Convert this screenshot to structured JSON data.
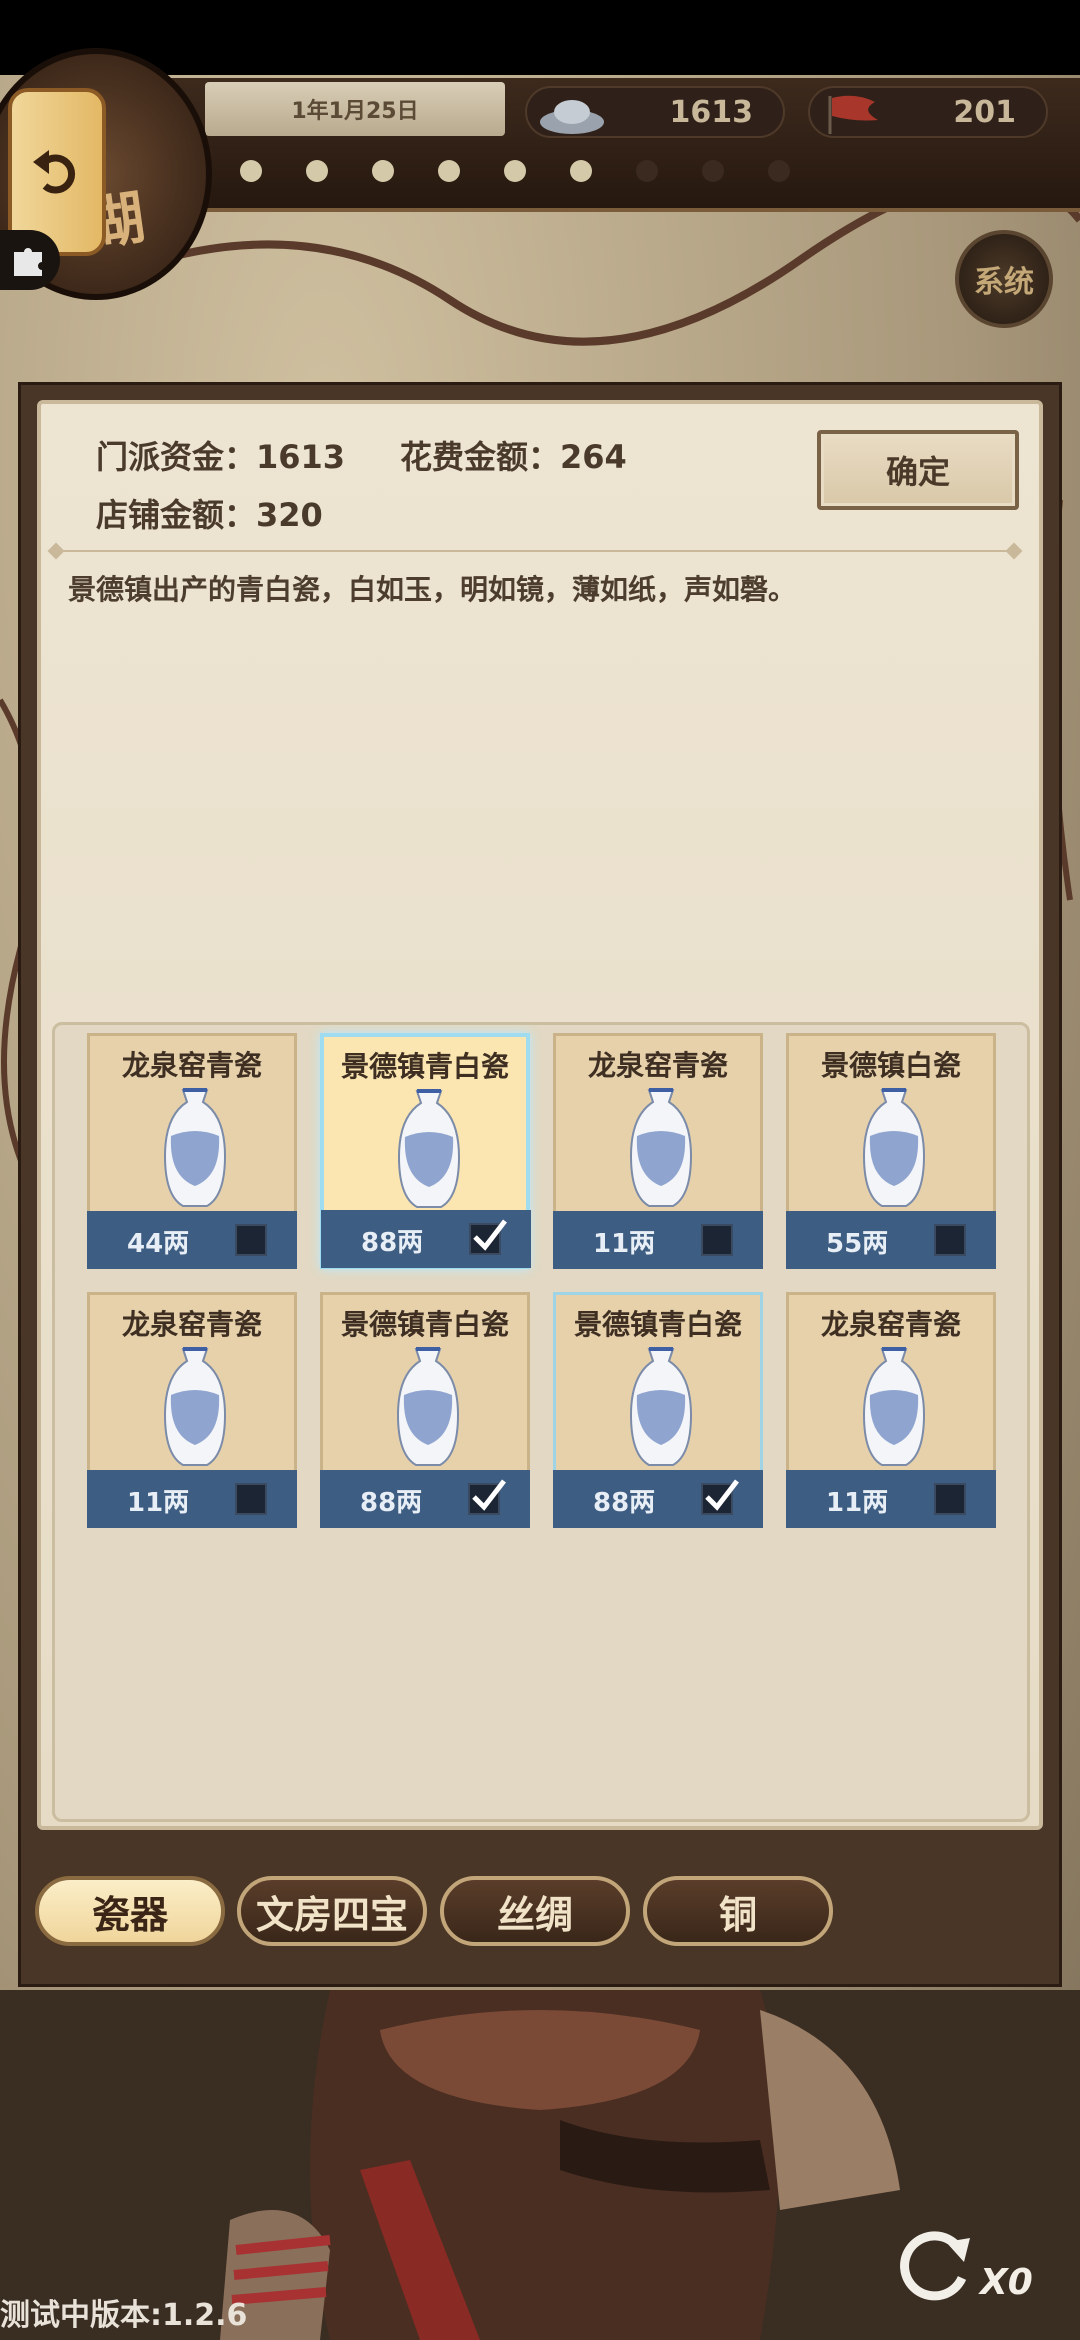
{
  "hud": {
    "date": "1年1月25日",
    "silver": "1613",
    "flag_count": "201",
    "emblem_text": "湖",
    "system_label": "系统"
  },
  "dialog": {
    "sect_funds_label": "门派资金：1613",
    "cost_label": "花费金额：264",
    "shop_label": "店铺金额：320",
    "confirm": "确定",
    "description": "景德镇出产的青白瓷，白如玉，明如镜，薄如纸，声如磬。"
  },
  "items": [
    {
      "name": "龙泉窑青瓷",
      "price": "44两",
      "checked": false
    },
    {
      "name": "景德镇青白瓷",
      "price": "88两",
      "checked": true
    },
    {
      "name": "龙泉窑青瓷",
      "price": "11两",
      "checked": false
    },
    {
      "name": "景德镇白瓷",
      "price": "55两",
      "checked": false
    },
    {
      "name": "龙泉窑青瓷",
      "price": "11两",
      "checked": false
    },
    {
      "name": "景德镇青白瓷",
      "price": "88两",
      "checked": true
    },
    {
      "name": "景德镇青白瓷",
      "price": "88两",
      "checked": true
    },
    {
      "name": "龙泉窑青瓷",
      "price": "11两",
      "checked": false
    }
  ],
  "tabs": [
    "瓷器",
    "文房四宝",
    "丝绸",
    "铜"
  ],
  "footer": {
    "version": "测试中版本:1.2.6",
    "refresh_count": "X0"
  },
  "colors": {
    "card_footer": "#3e5d82",
    "selected_border": "#9fdcf0",
    "tab_active": "#f0d59b"
  }
}
